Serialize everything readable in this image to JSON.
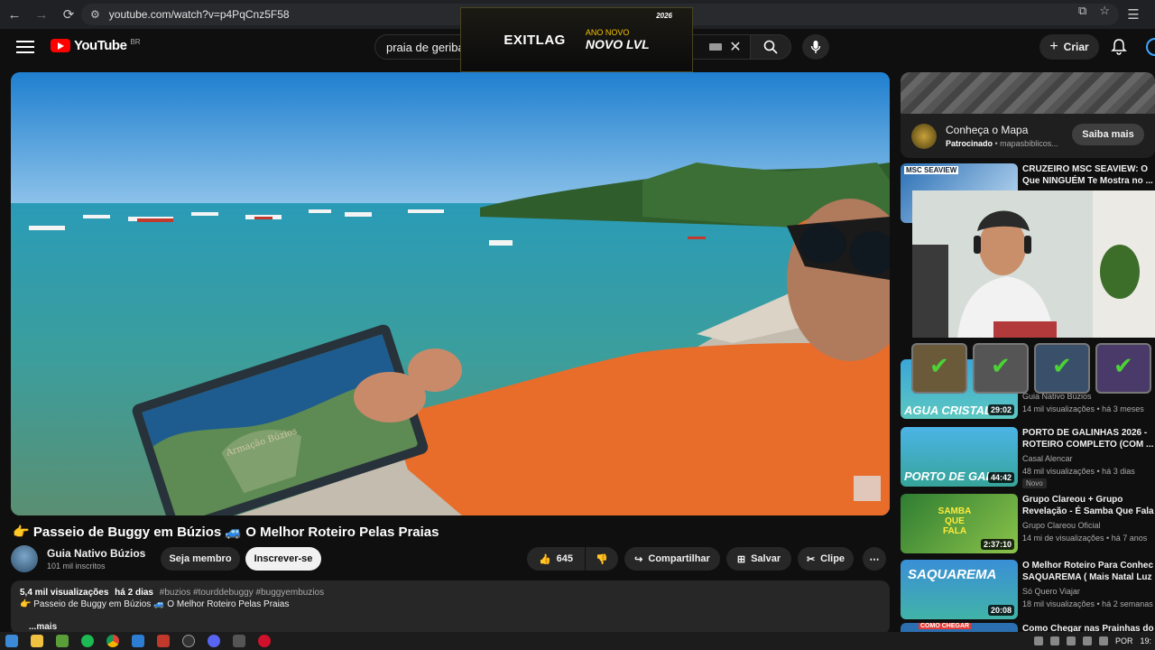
{
  "browser": {
    "url": "youtube.com/watch?v=p4PqCnz5F58"
  },
  "overlay_ad": {
    "logo": "EXITLAG",
    "line1": "ANO NOVO",
    "line2": "NOVO LVL",
    "year": "2026"
  },
  "header": {
    "logo_text": "YouTube",
    "region": "BR",
    "search_value": "praia de geriba",
    "create_label": "Criar"
  },
  "video": {
    "title": "👉 Passeio de Buggy em Búzios 🚙 O Melhor Roteiro Pelas Praias",
    "map_label": "Armação Búzios"
  },
  "channel": {
    "name": "Guia Nativo Búzios",
    "subscribers": "101 mil inscritos",
    "member_label": "Seja membro",
    "subscribe_label": "Inscrever-se"
  },
  "actions": {
    "likes": "645",
    "share": "Compartilhar",
    "save": "Salvar",
    "clip": "Clipe"
  },
  "description": {
    "views": "5,4 mil visualizações",
    "age": "há 2 dias",
    "tags": "#buzios #tourddebuggy #buggyembuzios",
    "line2": "👉 Passeio de Buggy em Búzios 🚙 O Melhor Roteiro Pelas Praias",
    "more": "...mais"
  },
  "sidebar_ad": {
    "title": "Conheça o Mapa",
    "sponsored": "Patrocinado",
    "domain": "mapasbiblicos...",
    "button": "Saiba mais"
  },
  "recommendations": [
    {
      "title1": "CRUZEIRO MSC SEAVIEW: O",
      "title2": "Que NINGUÉM Te Mostra no ...",
      "thumb_text": "MSC SEAVIEW",
      "channel": "",
      "meta": "",
      "duration": ""
    },
    {
      "title1": "",
      "title2": "",
      "thumb_text": "AGUA CRISTAL",
      "channel": "Guia Nativo Búzios",
      "meta": "14 mil visualizações • há 3 meses",
      "duration": "29:02"
    },
    {
      "title1": "PORTO DE GALINHAS 2026 -",
      "title2": "ROTEIRO COMPLETO (COM ...",
      "thumb_text": "PORTO DE GALI",
      "channel": "Casal Alencar",
      "meta": "48 mil visualizações • há 3 dias",
      "duration": "44:42",
      "badge": "Novo"
    },
    {
      "title1": "Grupo Clareou + Grupo",
      "title2": "Revelação - É Samba Que Fala",
      "thumb_text": "SAMBA QUE FALA",
      "channel": "Grupo Clareou Oficial",
      "meta": "14 mi de visualizações • há 7 anos",
      "duration": "2:37:10"
    },
    {
      "title1": "O Melhor Roteiro Para Conhec",
      "title2": "SAQUAREMA ( Mais Natal Luz",
      "thumb_text": "SAQUAREMA",
      "channel": "Só Quero Viajar",
      "meta": "18 mil visualizações • há 2 semanas",
      "duration": "20:08"
    },
    {
      "title1": "Como Chegar nas Prainhas do",
      "title2": "",
      "thumb_text": "COMO CHEGAR",
      "channel": "",
      "meta": "",
      "duration": ""
    }
  ],
  "taskbar": {
    "lang": "POR",
    "time": "19:"
  }
}
